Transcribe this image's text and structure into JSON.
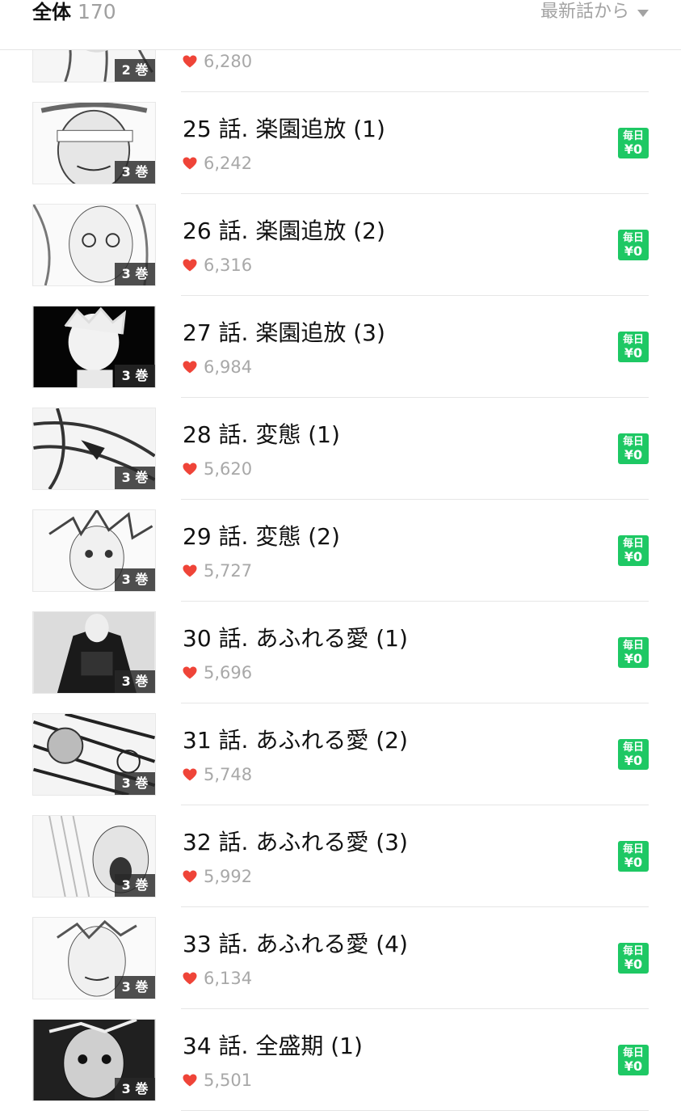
{
  "header": {
    "title": "全体",
    "count": "170",
    "sort_label": "最新話から"
  },
  "colors": {
    "accent_green": "#1ec864",
    "heart_red": "#ef4438",
    "muted_text": "#a8a8a8"
  },
  "icons": {
    "like": "heart-icon",
    "sort": "caret-down-icon"
  },
  "episodes": [
    {
      "title": "",
      "likes": "6,280",
      "volume": "2 巻",
      "badge": null
    },
    {
      "title": "25 話. 楽園追放 (1)",
      "likes": "6,242",
      "volume": "3 巻",
      "badge": {
        "top": "毎日",
        "bottom": "¥0"
      }
    },
    {
      "title": "26 話. 楽園追放 (2)",
      "likes": "6,316",
      "volume": "3 巻",
      "badge": {
        "top": "毎日",
        "bottom": "¥0"
      }
    },
    {
      "title": "27 話. 楽園追放 (3)",
      "likes": "6,984",
      "volume": "3 巻",
      "badge": {
        "top": "毎日",
        "bottom": "¥0"
      }
    },
    {
      "title": "28 話. 変態 (1)",
      "likes": "5,620",
      "volume": "3 巻",
      "badge": {
        "top": "毎日",
        "bottom": "¥0"
      }
    },
    {
      "title": "29 話. 変態 (2)",
      "likes": "5,727",
      "volume": "3 巻",
      "badge": {
        "top": "毎日",
        "bottom": "¥0"
      }
    },
    {
      "title": "30 話. あふれる愛 (1)",
      "likes": "5,696",
      "volume": "3 巻",
      "badge": {
        "top": "毎日",
        "bottom": "¥0"
      }
    },
    {
      "title": "31 話. あふれる愛 (2)",
      "likes": "5,748",
      "volume": "3 巻",
      "badge": {
        "top": "毎日",
        "bottom": "¥0"
      }
    },
    {
      "title": "32 話. あふれる愛 (3)",
      "likes": "5,992",
      "volume": "3 巻",
      "badge": {
        "top": "毎日",
        "bottom": "¥0"
      }
    },
    {
      "title": "33 話. あふれる愛 (4)",
      "likes": "6,134",
      "volume": "3 巻",
      "badge": {
        "top": "毎日",
        "bottom": "¥0"
      }
    },
    {
      "title": "34 話. 全盛期 (1)",
      "likes": "5,501",
      "volume": "3 巻",
      "badge": {
        "top": "毎日",
        "bottom": "¥0"
      }
    }
  ]
}
